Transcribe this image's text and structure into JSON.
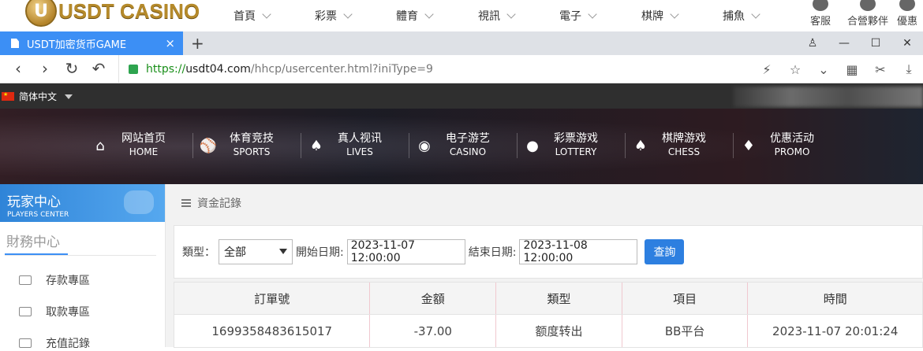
{
  "site": {
    "logo_text": "USDT CASINO",
    "logo_badge": "U",
    "menu": [
      "首頁",
      "彩票",
      "體育",
      "視訊",
      "電子",
      "棋牌",
      "捕魚"
    ],
    "icons": [
      {
        "label": "客服",
        "icon": "chat-icon"
      },
      {
        "label": "合營夥伴",
        "icon": "partner-icon"
      },
      {
        "label": "優惠",
        "icon": "gift-icon"
      }
    ]
  },
  "browser": {
    "tab_title": "USDT加密货币GAME",
    "tab_close": "×",
    "new_tab": "+",
    "url_scheme": "https://",
    "url_host": "usdt04.com",
    "url_path": "/hhcp/usercenter.html?iniType=9"
  },
  "lang": {
    "label": "简体中文"
  },
  "hero_nav": [
    {
      "cn": "网站首页",
      "en": "HOME",
      "icon": "home-icon",
      "glyph": "⌂"
    },
    {
      "cn": "体育竞技",
      "en": "SPORTS",
      "icon": "ball-icon",
      "glyph": "⚾"
    },
    {
      "cn": "真人视讯",
      "en": "LIVES",
      "icon": "cards-icon",
      "glyph": "♠"
    },
    {
      "cn": "电子游艺",
      "en": "CASINO",
      "icon": "slot-icon",
      "glyph": "◉"
    },
    {
      "cn": "彩票游戏",
      "en": "LOTTERY",
      "icon": "lottery-icon",
      "glyph": "●"
    },
    {
      "cn": "棋牌游戏",
      "en": "CHESS",
      "icon": "spade-icon",
      "glyph": "♠"
    },
    {
      "cn": "优惠活动",
      "en": "PROMO",
      "icon": "gift-icon",
      "glyph": "♦"
    }
  ],
  "sidebar": {
    "head_cn": "玩家中心",
    "head_en": "PLAYERS CENTER",
    "section": "財務中心",
    "items": [
      "存款專區",
      "取款專區",
      "充值記錄"
    ]
  },
  "main": {
    "crumb": "資金記錄",
    "filter": {
      "type_label": "類型：",
      "type_value": "全部",
      "start_label": "開始日期:",
      "start_value": "2023-11-07 12:00:00",
      "end_label": "結束日期:",
      "end_value": "2023-11-08 12:00:00",
      "query_button": "查詢"
    },
    "table": {
      "headers": [
        "訂單號",
        "金額",
        "類型",
        "項目",
        "時間"
      ],
      "rows": [
        [
          "1699358483615017",
          "-37.00",
          "额度转出",
          "BB平台",
          "2023-11-07 20:01:24"
        ]
      ]
    }
  }
}
